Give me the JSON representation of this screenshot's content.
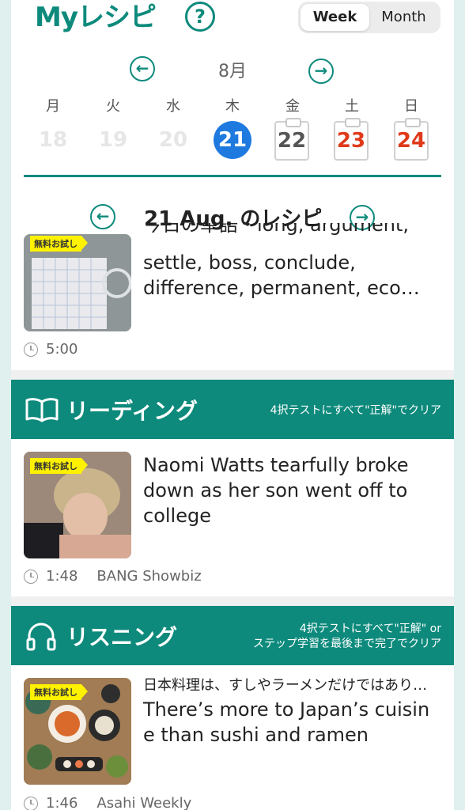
{
  "header": {
    "title": "Myレシピ",
    "help": "?",
    "views": [
      "Week",
      "Month"
    ],
    "active_view": "Week"
  },
  "calendar": {
    "month": "8月",
    "weekdays": [
      "月",
      "火",
      "水",
      "木",
      "金",
      "土",
      "日"
    ],
    "days": [
      "18",
      "19",
      "20",
      "21",
      "22",
      "23",
      "24"
    ],
    "prev": "←",
    "next": "→"
  },
  "recipe_header": {
    "title": "21 Aug. のレシピ",
    "prev": "←",
    "next": "→"
  },
  "vocab_card": {
    "badge": "無料お試し",
    "partial_line": "今日の単語・long, argument,",
    "text": "settle, boss, conclude, difference, permanent, eco…",
    "duration": "5:00"
  },
  "reading": {
    "title": "リーディング",
    "note": "4択テストにすべて\"正解\"でクリア",
    "card": {
      "badge": "無料お試し",
      "text": "Naomi Watts tearfully broke down as her son went off to college",
      "duration": "1:48",
      "source": "BANG Showbiz"
    }
  },
  "listening": {
    "title": "リスニング",
    "note_line1": "4択テストにすべて\"正解\" or",
    "note_line2": "ステップ学習を最後まで完了でクリア",
    "card": {
      "badge": "無料お試し",
      "subtitle": "日本料理は、すしやラーメンだけではあり…",
      "text": "There’s more to Japan’s cuisine than sushi and ramen",
      "duration": "1:46",
      "source": "Asahi Weekly"
    }
  },
  "colors": {
    "accent": "#0d8a7c",
    "today": "#1f7ae0",
    "weekend": "#e03a1b",
    "badge": "#fff200"
  }
}
